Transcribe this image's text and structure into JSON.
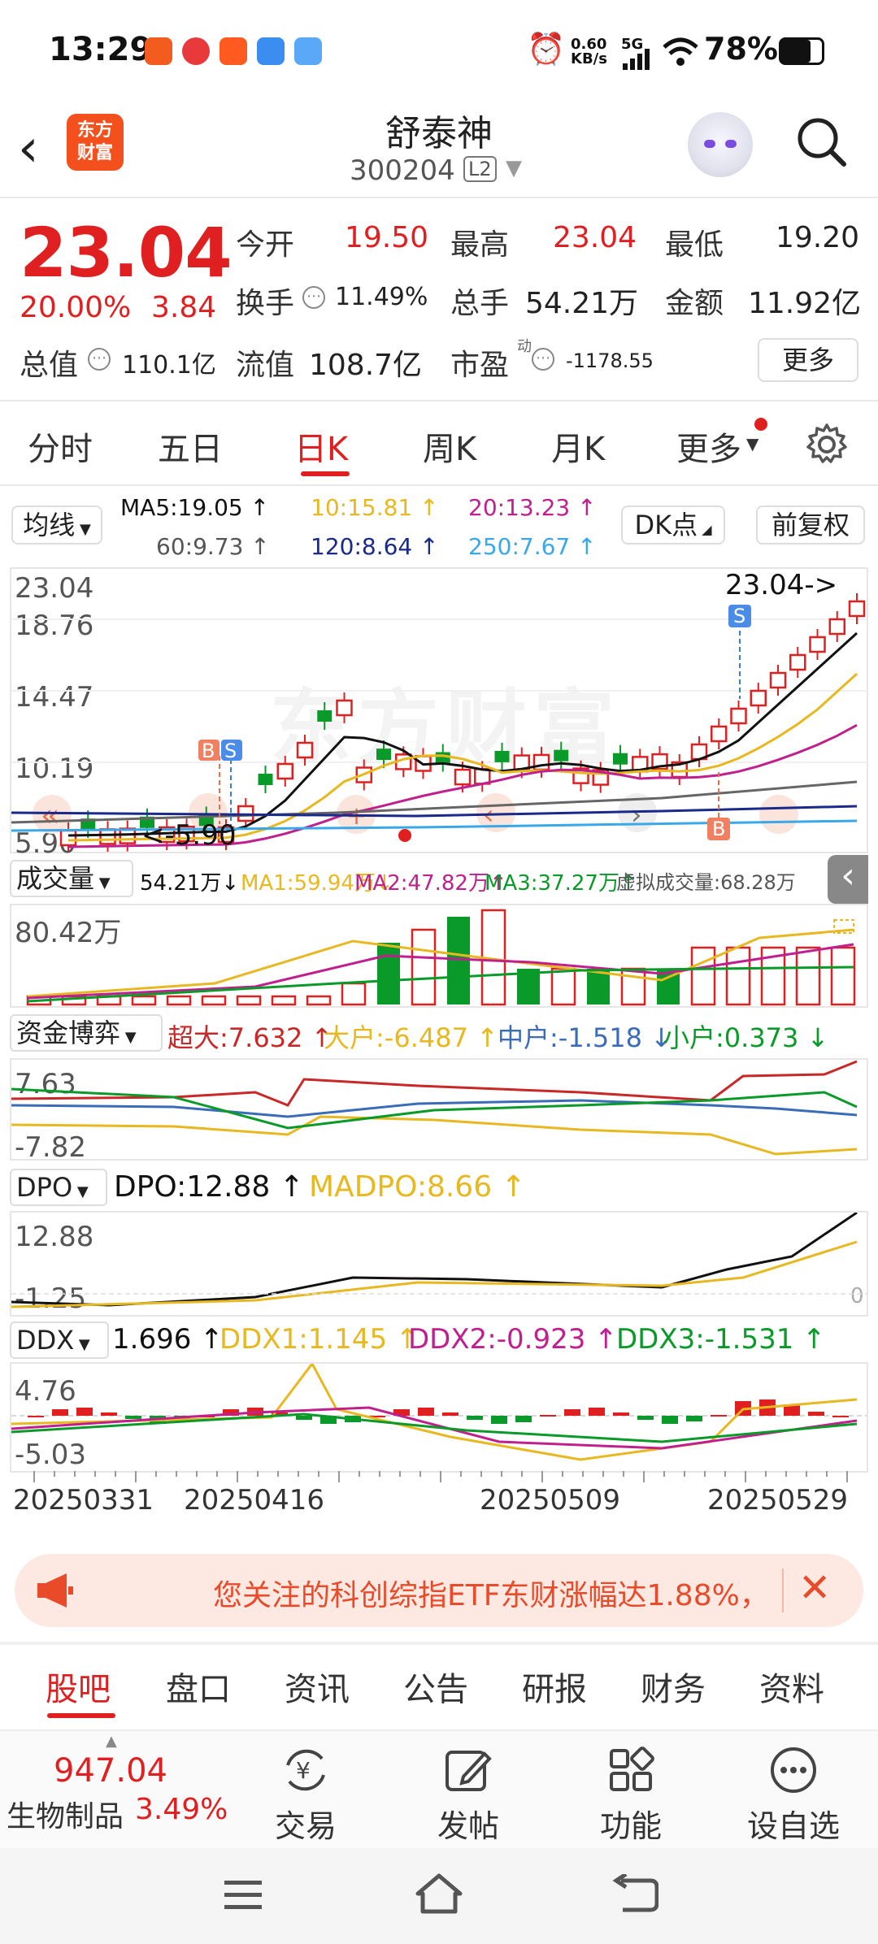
{
  "status": {
    "time": "13:29",
    "net_speed_top": "0.60",
    "net_speed_bottom": "KB/s",
    "network": "5G",
    "battery": "78%"
  },
  "header": {
    "brand_line1": "东方",
    "brand_line2": "财富",
    "stock_name": "舒泰神",
    "stock_code": "300204",
    "level_badge": "L2"
  },
  "quote": {
    "price": "23.04",
    "change_pct": "20.00%",
    "change_val": "3.84",
    "open_label": "今开",
    "open": "19.50",
    "high_label": "最高",
    "high": "23.04",
    "low_label": "最低",
    "low": "19.20",
    "turnover_label": "换手",
    "turnover": "11.49%",
    "volume_label": "总手",
    "volume": "54.21万",
    "amount_label": "金额",
    "amount": "11.92亿",
    "mktcap_label": "总值",
    "mktcap": "110.1亿",
    "float_label": "流值",
    "float": "108.7亿",
    "pe_label": "市盈",
    "pe_sup": "动",
    "pe": "-1178.55",
    "more_label": "更多"
  },
  "period_tabs": [
    "分时",
    "五日",
    "日K",
    "周K",
    "月K",
    "更多"
  ],
  "ma_row": {
    "selector": "均线",
    "ma5": "MA5:19.05 ↑",
    "ma10": "10:15.81 ↑",
    "ma20": "20:13.23 ↑",
    "ma60": "60:9.73 ↑",
    "ma120": "120:8.64 ↑",
    "ma250": "250:7.67 ↑",
    "dk_label": "DK点",
    "adjust_label": "前复权"
  },
  "kline": {
    "y_top": "23.04",
    "y2": "18.76",
    "y3": "14.47",
    "y4": "10.19",
    "y_bottom": "5.90",
    "high_marker": "23.04->",
    "low_marker": "<-5.90",
    "watermark": "东方财富",
    "b_label": "B",
    "s_label": "S"
  },
  "volume": {
    "selector": "成交量",
    "current": "54.21万↓",
    "ma1": "MA1:59.94万↓",
    "ma2": "MA2:47.82万↑",
    "ma3": "MA3:37.27万↑",
    "virtual": "虚拟成交量:68.28万",
    "y_top": "80.42万"
  },
  "capital": {
    "selector": "资金博弈",
    "super": "超大:7.632 ↑",
    "large": "大户:-6.487 ↑",
    "medium": "中户:-1.518 ↓",
    "small": "小户:0.373 ↓",
    "y_top": "7.63",
    "y_bottom": "-7.82"
  },
  "dpo": {
    "selector": "DPO",
    "dpo": "DPO:12.88 ↑",
    "madpo": "MADPO:8.66 ↑",
    "y_top": "12.88",
    "y_bottom": "-1.25",
    "zero": "0"
  },
  "ddx": {
    "selector": "DDX",
    "ddx": "1.696 ↑",
    "ddx1": "DDX1:1.145 ↑",
    "ddx2": "DDX2:-0.923 ↑",
    "ddx3": "DDX3:-1.531 ↑",
    "y_top": "4.76",
    "y_bottom": "-5.03"
  },
  "dates": [
    "20250331",
    "20250416",
    "20250509",
    "20250529"
  ],
  "notice": {
    "text": "您关注的科创综指ETF东财涨幅达1.88%，"
  },
  "bottom_tabs": [
    "股吧",
    "盘口",
    "资讯",
    "公告",
    "研报",
    "财务",
    "资料"
  ],
  "bottom_bar": {
    "index_value": "947.04",
    "index_name": "生物制品",
    "index_pct": "3.49%",
    "trade": "交易",
    "post": "发帖",
    "function": "功能",
    "watchlist": "设自选"
  },
  "colors": {
    "up": "#e02020",
    "down": "#0a9a2a",
    "ma5": "#111111",
    "ma10": "#e8b820",
    "ma20": "#c0208e",
    "ma60": "#666666",
    "ma120": "#1a2a8a",
    "ma250": "#3aa8e8"
  }
}
